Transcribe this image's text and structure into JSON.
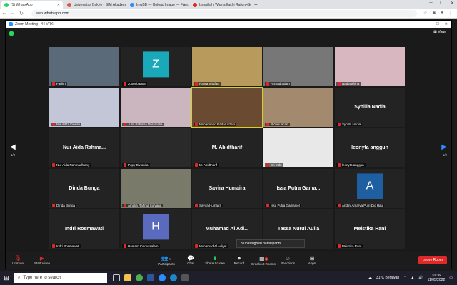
{
  "browser": {
    "tabs": [
      {
        "label": "(1) WhatsApp",
        "color": "#25d366",
        "active": true
      },
      {
        "label": "Universitas Bakrie - SIM Akadem...",
        "color": "#d9534f",
        "active": false
      },
      {
        "label": "ImgBB — Upload Image — Free...",
        "color": "#2d8cff",
        "active": false
      },
      {
        "label": "Ismaillahi Wama Ilachi Rajiun, Sou...",
        "color": "#e02828",
        "active": false
      }
    ],
    "new_tab": "+",
    "url": "web.whatsapp.com"
  },
  "zoom": {
    "title": "Zoom Meeting - 44 VRKf",
    "view_label": "View",
    "page_left": "1/2",
    "page_right": "1/2",
    "tiles": [
      {
        "name": "Fadhri",
        "type": "video",
        "bg": "#5a6a78"
      },
      {
        "name": "zoom baa04",
        "type": "avatar",
        "letter": "Z",
        "avcolor": "#1aa9b8"
      },
      {
        "name": "Rahra Shafaa",
        "type": "video",
        "bg": "#b79a5c"
      },
      {
        "name": "Ahmad adam",
        "type": "video",
        "bg": "#777"
      },
      {
        "name": "Nadia afrina",
        "type": "video",
        "bg": "#d8b7c0"
      },
      {
        "name": "Maulidita Kinesh",
        "type": "video",
        "bg": "#c2c6d6"
      },
      {
        "name": "Julia Batrissa Nuramalia",
        "type": "video",
        "bg": "#cbb5bf"
      },
      {
        "name": "Muhammad Radaruzzaki",
        "type": "video",
        "bg": "#6b4a32",
        "active": true
      },
      {
        "name": "Richel lacan",
        "type": "video",
        "bg": "#a38a6f"
      },
      {
        "name": "Syhilla Nadia",
        "type": "text",
        "display": "Syhilla Nadia"
      },
      {
        "name": "Nur Aida Rahmadhiany",
        "type": "text",
        "display": "Nur Aida Rahma..."
      },
      {
        "name": "Popy Elvionita",
        "type": "video",
        "bg": "#2a2a2a"
      },
      {
        "name": "M. Abidtharif",
        "type": "text",
        "display": "M. Abidtharif"
      },
      {
        "name": "Sri Indri",
        "type": "video",
        "bg": "#e8e8e8"
      },
      {
        "name": "leonyta anggun",
        "type": "text",
        "display": "leonyta anggun"
      },
      {
        "name": "Dinda Bunga",
        "type": "text",
        "display": "Dinda Bunga"
      },
      {
        "name": "Amalia Rahma Sofyana",
        "type": "video",
        "bg": "#7a7a6a"
      },
      {
        "name": "Savira Humaira",
        "type": "text",
        "display": "Savira Humaira"
      },
      {
        "name": "Issa Putra Gamaniel",
        "type": "text",
        "display": "Issa Putra Gama..."
      },
      {
        "name": "Andini Amarya Putri Djo Hau",
        "type": "avatar",
        "letter": "A",
        "avcolor": "#1d5fa0"
      },
      {
        "name": "Indri Rosmawati",
        "type": "text",
        "display": "Indri Rosmawati"
      },
      {
        "name": "Hamam Ibadussalam",
        "type": "avatar",
        "letter": "H",
        "avcolor": "#5a6bbf"
      },
      {
        "name": "Muhamad Al Adiyat",
        "type": "text",
        "display": "Muhamad Al Adi..."
      },
      {
        "name": "Tassa Nurul Aulia",
        "type": "text",
        "display": "Tassa Nurul Aulia"
      },
      {
        "name": "Meistika Rani",
        "type": "text",
        "display": "Meistika Rani"
      }
    ],
    "tooltip": "3 unassigned participants",
    "toolbar": {
      "unmute": "Unmute",
      "start_video": "Start Video",
      "participants": "Participants",
      "participants_count": "27",
      "chat": "Chat",
      "share_screen": "Share Screen",
      "record": "Record",
      "breakout": "Breakout Rooms",
      "breakout_badge": "3",
      "reactions": "Reactions",
      "apps": "Apps",
      "leave": "Leave Room"
    }
  },
  "taskbar": {
    "search_placeholder": "Type here to search",
    "weather": "31°C  Berawan",
    "time": "10:36",
    "date": "11/05/2022"
  }
}
